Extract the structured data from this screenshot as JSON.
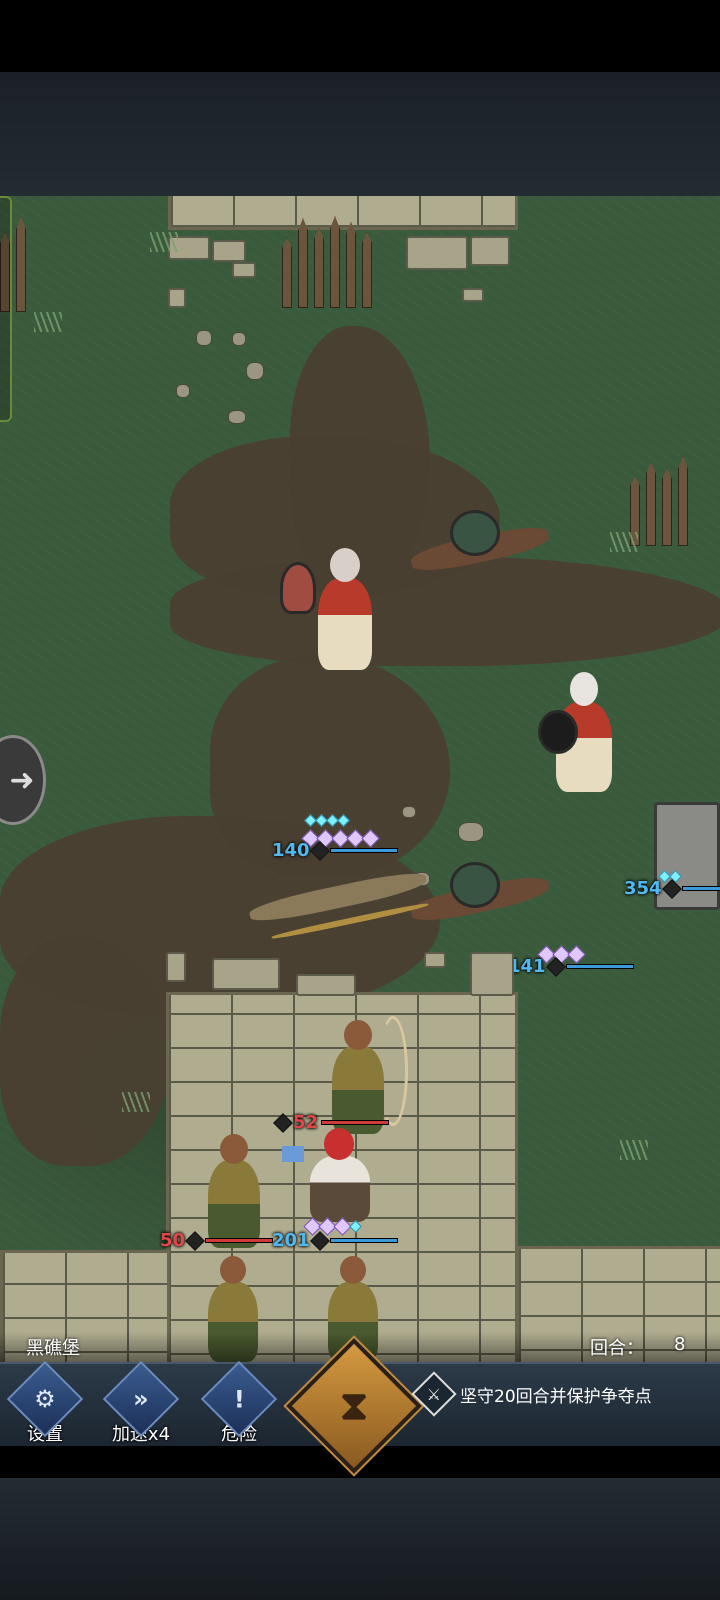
{
  "map_name": "黑礁堡",
  "round": {
    "label": "回合：",
    "value": "8"
  },
  "toolbar": {
    "settings": {
      "icon": "gears-icon",
      "label": "设置"
    },
    "speed": {
      "icon": "fast-forward-icon",
      "label": "加速x4"
    },
    "danger": {
      "icon": "exclamation-icon",
      "label": "危险"
    },
    "end_turn": {
      "icon": "hourglass-icon"
    }
  },
  "objective": {
    "icon": "crossed-swords-icon",
    "text": "坚守20回合并保护争夺点"
  },
  "side_arrow": {
    "icon": "arrow-right-icon"
  },
  "units": {
    "enemy_priest_1": {
      "hp": "140",
      "hp_ratio": 1.0,
      "team": "enemy",
      "gems": 5,
      "small_gems": 4
    },
    "enemy_priest_2": {
      "hp": "141",
      "hp_ratio": 1.0,
      "team": "enemy",
      "gems": 3,
      "small_gems": 0
    },
    "enemy_shieldbearer": {
      "hp": "354",
      "hp_ratio": 1.0,
      "team": "enemy",
      "gems": 0,
      "small_gems": 2
    },
    "ally_archer_top": {
      "hp": "52",
      "hp_ratio": 1.0,
      "team": "ally"
    },
    "ally_hero": {
      "hp": "201",
      "hp_ratio": 1.0,
      "team": "ally",
      "gems": 3,
      "small_gems": 1
    },
    "ally_archer_left": {
      "hp": "50",
      "hp_ratio": 1.0,
      "team": "ally"
    }
  },
  "colors": {
    "ally_hp": "#e04848",
    "enemy_hp": "#52b8f0",
    "grass": "#3a5a3c",
    "dirt": "#4a3f30"
  }
}
